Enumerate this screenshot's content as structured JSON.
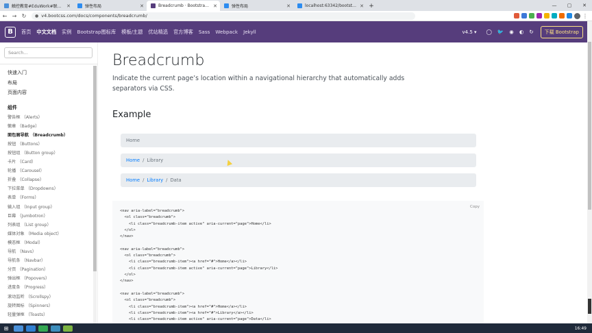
{
  "browser": {
    "tabs": [
      {
        "title": "触控教育#EduWork#联工作中平",
        "color": "#4a90d9"
      },
      {
        "title": "弹性布局",
        "color": "#2d8cf0"
      },
      {
        "title": "Breadcrumb · Bootstrap v4.5",
        "color": "#563d7c"
      },
      {
        "title": "弹性布局",
        "color": "#2d8cf0"
      },
      {
        "title": "localhost:63342/bootstrap/1/...",
        "color": "#2d8cf0"
      }
    ],
    "active_tab_index": 2,
    "new_tab_label": "+",
    "url": "v4.bootcss.com/docs/components/breadcrumb/",
    "window_controls": [
      "—",
      "▢",
      "✕"
    ],
    "nav": {
      "back": "←",
      "forward": "→",
      "reload": "↻",
      "lock": "🔒"
    },
    "ext_colors": [
      "#e05a3a",
      "#3c78d8",
      "#4caf50",
      "#9c27b0",
      "#f4b400",
      "#00acc1",
      "#ef6c00",
      "#1e88e5"
    ],
    "menu": "⋮"
  },
  "site_nav": {
    "brand": "B",
    "links": [
      "首页",
      "中文文档",
      "实例",
      "Bootstrap图标库",
      "模板/主题",
      "优站精选",
      "官方博客",
      "Sass",
      "Webpack",
      "Jekyll"
    ],
    "active_index": 1,
    "version": "v4.5 ▾",
    "socials": [
      "◯",
      "🐦",
      "◉",
      "◐",
      "↻"
    ],
    "download": "下载 Bootstrap"
  },
  "sidebar": {
    "search_placeholder": "Search...",
    "top_sections": [
      "快速入门",
      "布局",
      "页面内容"
    ],
    "group": "组件",
    "items": [
      "警告框 （Alerts）",
      "徽章 （Badge）",
      "面包屑导航 （Breadcrumb）",
      "按钮 （Buttons）",
      "按钮组 （Button group）",
      "卡片 （Card）",
      "轮播 （Carousel）",
      "折叠 （Collapse）",
      "下拉菜单 （Dropdowns）",
      "表单 （Forms）",
      "输入组 （Input group）",
      "巨幕 （Jumbotron）",
      "列表组 （List group）",
      "媒体对象 （Media object）",
      "模态框 （Modal）",
      "导航 （Navs）",
      "导航条 （Navbar）",
      "分页 （Pagination）",
      "弹出框 （Popovers）",
      "进度条 （Progress）",
      "滚动监听 （Scrollspy）",
      "旋转图标 （Spinners）",
      "轻量弹框 （Toasts）"
    ],
    "active_item_index": 2
  },
  "main": {
    "title": "Breadcrumb",
    "lead": "Indicate the current page’s location within a navigational hierarchy that automatically adds separators via CSS.",
    "example_heading": "Example",
    "breadcrumbs": [
      {
        "links": [],
        "current": "Home"
      },
      {
        "links": [
          "Home"
        ],
        "current": "Library"
      },
      {
        "links": [
          "Home",
          "Library"
        ],
        "current": "Data"
      }
    ],
    "separator": "/",
    "copy_label": "Copy",
    "code_lines": [
      "<nav aria-label=\"breadcrumb\">",
      "  <ol class=\"breadcrumb\">",
      "    <li class=\"breadcrumb-item active\" aria-current=\"page\">Home</li>",
      "  </ol>",
      "</nav>",
      "",
      "<nav aria-label=\"breadcrumb\">",
      "  <ol class=\"breadcrumb\">",
      "    <li class=\"breadcrumb-item\"><a href=\"#\">Home</a></li>",
      "    <li class=\"breadcrumb-item active\" aria-current=\"page\">Library</li>",
      "  </ol>",
      "</nav>",
      "",
      "<nav aria-label=\"breadcrumb\">",
      "  <ol class=\"breadcrumb\">",
      "    <li class=\"breadcrumb-item\"><a href=\"#\">Home</a></li>",
      "    <li class=\"breadcrumb-item\"><a href=\"#\">Library</a></li>",
      "    <li class=\"breadcrumb-item active\" aria-current=\"page\">Data</li>"
    ]
  },
  "taskbar": {
    "start": "⊞",
    "icon_colors": [
      "#4a90d9",
      "#2f7fd1",
      "#34a853",
      "#3c8dbc",
      "#7cb342"
    ],
    "time": "16:49"
  },
  "colors": {
    "brand_purple": "#563d7c",
    "link_blue": "#007bff",
    "breadcrumb_bg": "#e9ecef"
  }
}
